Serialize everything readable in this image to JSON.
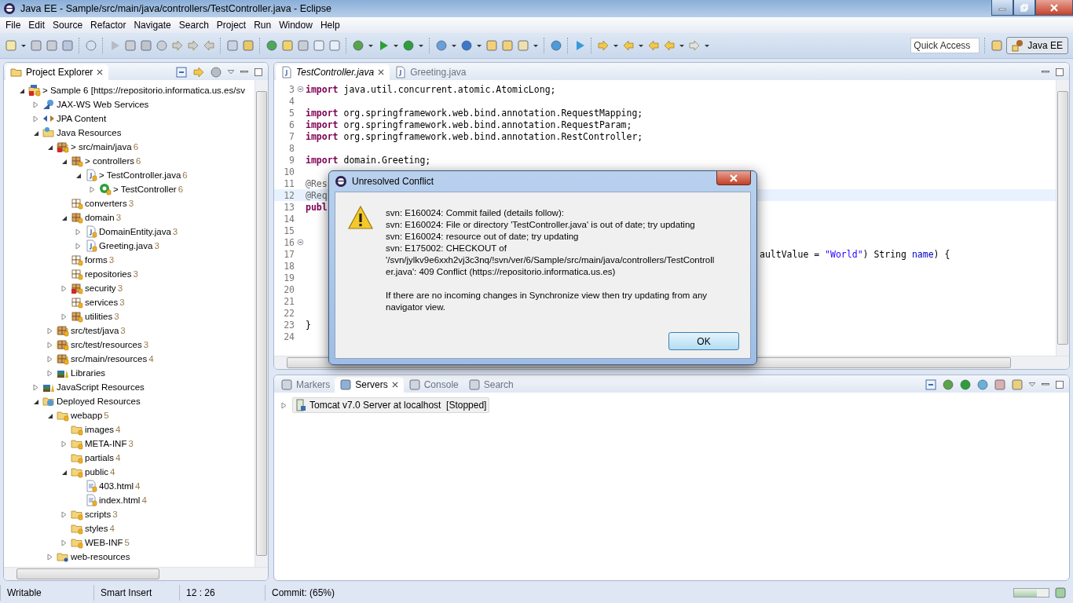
{
  "window": {
    "title": "Java EE - Sample/src/main/java/controllers/TestController.java - Eclipse"
  },
  "menu": [
    "File",
    "Edit",
    "Source",
    "Refactor",
    "Navigate",
    "Search",
    "Project",
    "Run",
    "Window",
    "Help"
  ],
  "quick_access": {
    "placeholder": "Quick Access"
  },
  "perspective": {
    "label": "Java EE",
    "selected": true
  },
  "project_explorer": {
    "title": "Project Explorer",
    "tree": [
      {
        "label": "> Sample 6 [https://repositorio.informatica.us.es/sv",
        "kind": "project",
        "expanded": true,
        "children": [
          {
            "label": "JAX-WS Web Services",
            "kind": "webservices",
            "expanded": false
          },
          {
            "label": "JPA Content",
            "kind": "jpa",
            "expanded": false
          },
          {
            "label": "Java Resources",
            "kind": "javares",
            "expanded": true,
            "children": [
              {
                "label": "> src/main/java",
                "count": "6",
                "kind": "srcfolder-error",
                "expanded": true,
                "children": [
                  {
                    "label": "> controllers",
                    "count": "6",
                    "kind": "package",
                    "expanded": true,
                    "children": [
                      {
                        "label": "> TestController.java",
                        "count": "6",
                        "kind": "java",
                        "expanded": true,
                        "children": [
                          {
                            "label": "> TestController",
                            "count": "6",
                            "kind": "class",
                            "expanded": false
                          }
                        ]
                      }
                    ]
                  },
                  {
                    "label": "converters",
                    "count": "3",
                    "kind": "package-empty"
                  },
                  {
                    "label": "domain",
                    "count": "3",
                    "kind": "package",
                    "expanded": true,
                    "children": [
                      {
                        "label": "DomainEntity.java",
                        "count": "3",
                        "kind": "java",
                        "expanded": false
                      },
                      {
                        "label": "Greeting.java",
                        "count": "3",
                        "kind": "java",
                        "expanded": false
                      }
                    ]
                  },
                  {
                    "label": "forms",
                    "count": "3",
                    "kind": "package-empty"
                  },
                  {
                    "label": "repositories",
                    "count": "3",
                    "kind": "package-empty"
                  },
                  {
                    "label": "security",
                    "count": "3",
                    "kind": "package-error",
                    "expanded": false
                  },
                  {
                    "label": "services",
                    "count": "3",
                    "kind": "package-empty"
                  },
                  {
                    "label": "utilities",
                    "count": "3",
                    "kind": "package",
                    "expanded": false
                  }
                ]
              },
              {
                "label": "src/test/java",
                "count": "3",
                "kind": "srcfolder",
                "expanded": false
              },
              {
                "label": "src/test/resources",
                "count": "3",
                "kind": "srcfolder",
                "expanded": false
              },
              {
                "label": "src/main/resources",
                "count": "4",
                "kind": "srcfolder",
                "expanded": false
              },
              {
                "label": "Libraries",
                "kind": "library",
                "expanded": false
              }
            ]
          },
          {
            "label": "JavaScript Resources",
            "kind": "library",
            "expanded": false
          },
          {
            "label": "Deployed Resources",
            "kind": "deployed",
            "expanded": true,
            "children": [
              {
                "label": "webapp",
                "count": "5",
                "kind": "folder",
                "expanded": true,
                "children": [
                  {
                    "label": "images",
                    "count": "4",
                    "kind": "folder"
                  },
                  {
                    "label": "META-INF",
                    "count": "3",
                    "kind": "folder",
                    "expanded": false
                  },
                  {
                    "label": "partials",
                    "count": "4",
                    "kind": "folder"
                  },
                  {
                    "label": "public",
                    "count": "4",
                    "kind": "folder",
                    "expanded": true,
                    "children": [
                      {
                        "label": "403.html",
                        "count": "4",
                        "kind": "html"
                      },
                      {
                        "label": "index.html",
                        "count": "4",
                        "kind": "html"
                      }
                    ]
                  },
                  {
                    "label": "scripts",
                    "count": "3",
                    "kind": "folder",
                    "expanded": false
                  },
                  {
                    "label": "styles",
                    "count": "4",
                    "kind": "folder"
                  },
                  {
                    "label": "WEB-INF",
                    "count": "5",
                    "kind": "folder",
                    "expanded": false
                  }
                ]
              },
              {
                "label": "web-resources",
                "kind": "folder-unknown",
                "expanded": false
              }
            ]
          }
        ]
      }
    ]
  },
  "editor": {
    "tabs": [
      {
        "label": "TestController.java",
        "selected": true
      },
      {
        "label": "Greeting.java",
        "selected": false
      }
    ],
    "lines": [
      {
        "number": "3",
        "fold": true,
        "current": false,
        "text": [
          {
            "t": "import",
            "kind": "keyword"
          },
          {
            "t": " java.util.concurrent.atomic.AtomicLong;",
            "kind": "plain"
          }
        ]
      },
      {
        "number": "4",
        "fold": false,
        "current": false
      },
      {
        "number": "5",
        "fold": false,
        "current": false,
        "text": [
          {
            "t": "import",
            "kind": "keyword"
          },
          {
            "t": " org.springframework.web.bind.annotation.RequestMapping;",
            "kind": "plain"
          }
        ]
      },
      {
        "number": "6",
        "fold": false,
        "current": false,
        "text": [
          {
            "t": "import",
            "kind": "keyword"
          },
          {
            "t": " org.springframework.web.bind.annotation.RequestParam;",
            "kind": "plain"
          }
        ]
      },
      {
        "number": "7",
        "fold": false,
        "current": false,
        "text": [
          {
            "t": "import",
            "kind": "keyword"
          },
          {
            "t": " org.springframework.web.bind.annotation.RestController;",
            "kind": "plain"
          }
        ]
      },
      {
        "number": "8",
        "fold": false,
        "current": false
      },
      {
        "number": "9",
        "fold": false,
        "current": false,
        "text": [
          {
            "t": "import",
            "kind": "keyword"
          },
          {
            "t": " domain.Greeting;",
            "kind": "plain"
          }
        ]
      },
      {
        "number": "10",
        "fold": false,
        "current": false
      },
      {
        "number": "11",
        "fold": false,
        "current": false,
        "text": [
          {
            "t": "@Res",
            "kind": "annotation"
          }
        ]
      },
      {
        "number": "12",
        "fold": false,
        "current": true,
        "text": [
          {
            "t": "@Req",
            "kind": "annotation"
          }
        ]
      },
      {
        "number": "13",
        "fold": false,
        "current": false,
        "text": [
          {
            "t": "publ",
            "kind": "keyword"
          }
        ]
      },
      {
        "number": "14",
        "fold": false,
        "current": false
      },
      {
        "number": "15",
        "fold": false,
        "current": false
      },
      {
        "number": "16",
        "fold": true,
        "current": false
      },
      {
        "number": "17",
        "fold": false,
        "current": false,
        "tail": [
          {
            "t": "aultValue = ",
            "kind": "plain"
          },
          {
            "t": "\"World\"",
            "kind": "string"
          },
          {
            "t": ") String ",
            "kind": "plain"
          },
          {
            "t": "name",
            "kind": "variable"
          },
          {
            "t": ") {",
            "kind": "plain"
          }
        ]
      },
      {
        "number": "18",
        "fold": false,
        "current": false
      },
      {
        "number": "19",
        "fold": false,
        "current": false
      },
      {
        "number": "20",
        "fold": false,
        "current": false
      },
      {
        "number": "21",
        "fold": false,
        "current": false
      },
      {
        "number": "22",
        "fold": false,
        "current": false
      },
      {
        "number": "23",
        "fold": false,
        "current": false,
        "text": [
          {
            "t": "}",
            "kind": "plain"
          }
        ]
      },
      {
        "number": "24",
        "fold": false,
        "current": false
      }
    ]
  },
  "bottom_panel": {
    "tabs": [
      {
        "label": "Markers",
        "selected": false
      },
      {
        "label": "Servers",
        "selected": true
      },
      {
        "label": "Console",
        "selected": false
      },
      {
        "label": "Search",
        "selected": false
      }
    ],
    "servers": [
      {
        "label": "Tomcat v7.0 Server at localhost  [Stopped]",
        "expanded": false
      }
    ]
  },
  "dialog": {
    "title": "Unresolved Conflict",
    "paragraphs": [
      [
        "svn: E160024: Commit failed (details follow):",
        "svn: E160024: File or directory 'TestController.java' is out of date; try updating",
        "svn: E160024: resource out of date; try updating",
        "svn: E175002: CHECKOUT of",
        "'/svn/jylkv9e6xxh2vj3c3nq/!svn/ver/6/Sample/src/main/java/controllers/TestControll",
        "er.java': 409 Conflict (https://repositorio.informatica.us.es)"
      ],
      [
        "If there are no incoming changes in Synchronize view then try updating from any",
        "navigator view."
      ]
    ],
    "buttons": [
      "OK"
    ]
  },
  "status_bar": {
    "mode": "Writable",
    "insert": "Smart Insert",
    "position": "12 : 26",
    "progress": "Commit: (65%)",
    "level": 0.65
  }
}
